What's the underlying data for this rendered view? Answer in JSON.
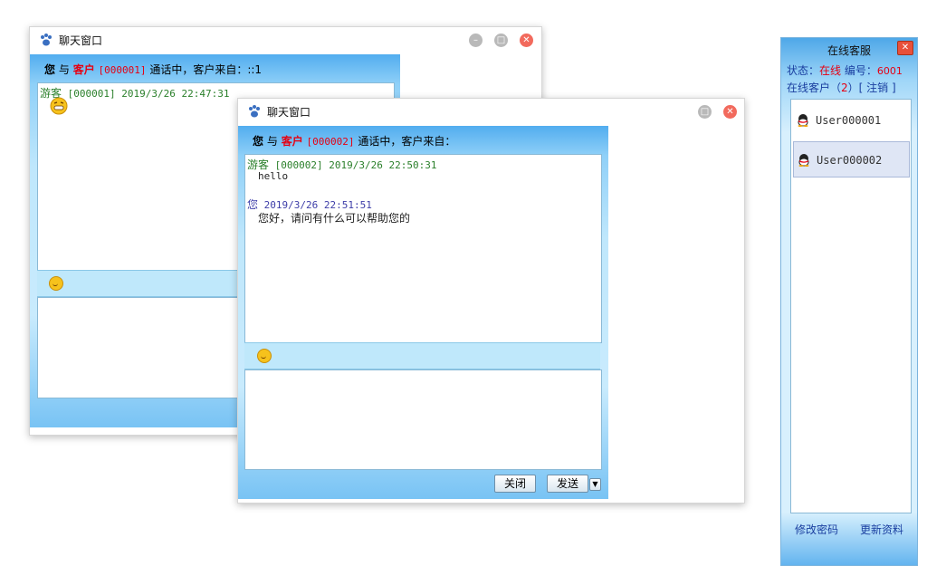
{
  "window1": {
    "title": "聊天窗口",
    "header": {
      "you": "您",
      "with": "与",
      "customer_label": "客户",
      "customer_id": "[000001]",
      "status": "通话中，客户来自：::1"
    },
    "messages": [
      {
        "who": "游客",
        "meta": "[000001] 2019/3/26 22:47:31"
      }
    ]
  },
  "window2": {
    "title": "聊天窗口",
    "header": {
      "you": "您",
      "with": "与",
      "customer_label": "客户",
      "customer_id": "[000002]",
      "status": "通话中，客户来自："
    },
    "messages": [
      {
        "who": "游客",
        "meta": "[000002] 2019/3/26 22:50:31",
        "text": "hello"
      },
      {
        "who": "您",
        "meta": "2019/3/26 22:51:51",
        "text": "您好，请问有什么可以帮助您的"
      }
    ],
    "buttons": {
      "close": "关闭",
      "send": "发送"
    }
  },
  "sidebar": {
    "title": "在线客服",
    "status_label": "状态：",
    "status_value": "在线",
    "id_label": "编号：",
    "id_value": "6001",
    "online_label": "在线客户（",
    "online_count": "2",
    "online_close": "）",
    "logout": "[ 注销 ]",
    "users": [
      "User000001",
      "User000002"
    ],
    "change_password": "修改密码",
    "update_profile": "更新资料"
  },
  "colors": {
    "accent": "#52adef",
    "red": "#e60012",
    "green": "#2a7f2a",
    "blue": "#3d3da8"
  }
}
